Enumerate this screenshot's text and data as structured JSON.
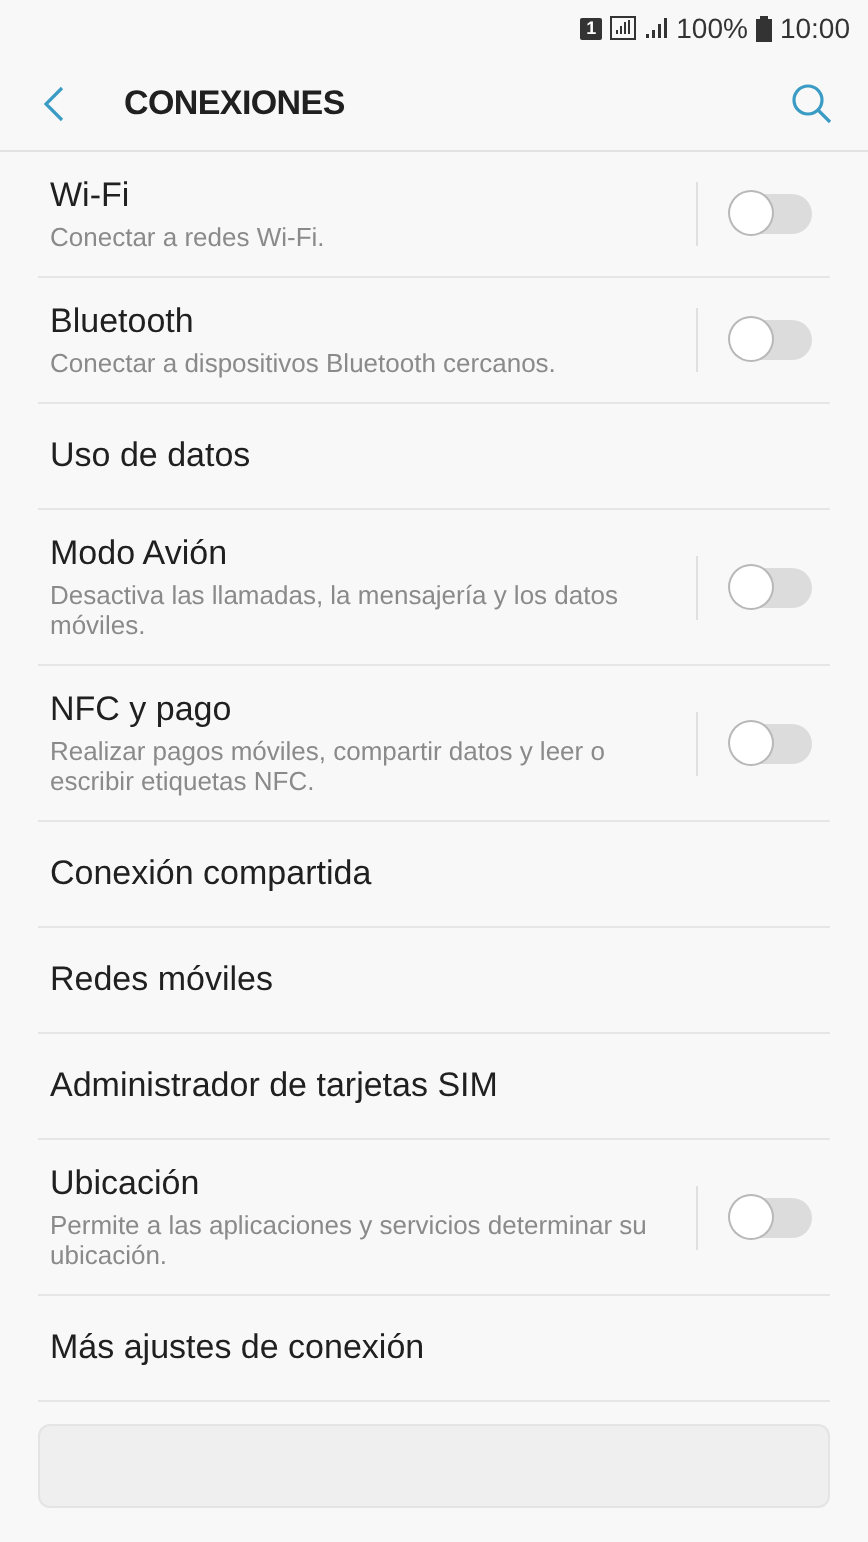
{
  "status_bar": {
    "sim": "1",
    "battery": "100%",
    "time": "10:00"
  },
  "header": {
    "title": "CONEXIONES"
  },
  "items": [
    {
      "kind": "toggle",
      "title": "Wi-Fi",
      "subtitle": "Conectar a redes Wi-Fi.",
      "on": false
    },
    {
      "kind": "toggle",
      "title": "Bluetooth",
      "subtitle": "Conectar a dispositivos Bluetooth cercanos.",
      "on": false
    },
    {
      "kind": "link",
      "title": "Uso de datos"
    },
    {
      "kind": "toggle",
      "title": "Modo Avión",
      "subtitle": "Desactiva las llamadas, la mensajería y los datos móviles.",
      "on": false
    },
    {
      "kind": "toggle",
      "title": "NFC y pago",
      "subtitle": "Realizar pagos móviles, compartir datos y leer o escribir etiquetas NFC.",
      "on": false
    },
    {
      "kind": "link",
      "title": "Conexión compartida"
    },
    {
      "kind": "link",
      "title": "Redes móviles"
    },
    {
      "kind": "link",
      "title": "Administrador de tarjetas SIM"
    },
    {
      "kind": "toggle",
      "title": "Ubicación",
      "subtitle": "Permite a las aplicaciones y servicios determinar su ubicación.",
      "on": false
    },
    {
      "kind": "link",
      "title": "Más ajustes de conexión"
    }
  ]
}
